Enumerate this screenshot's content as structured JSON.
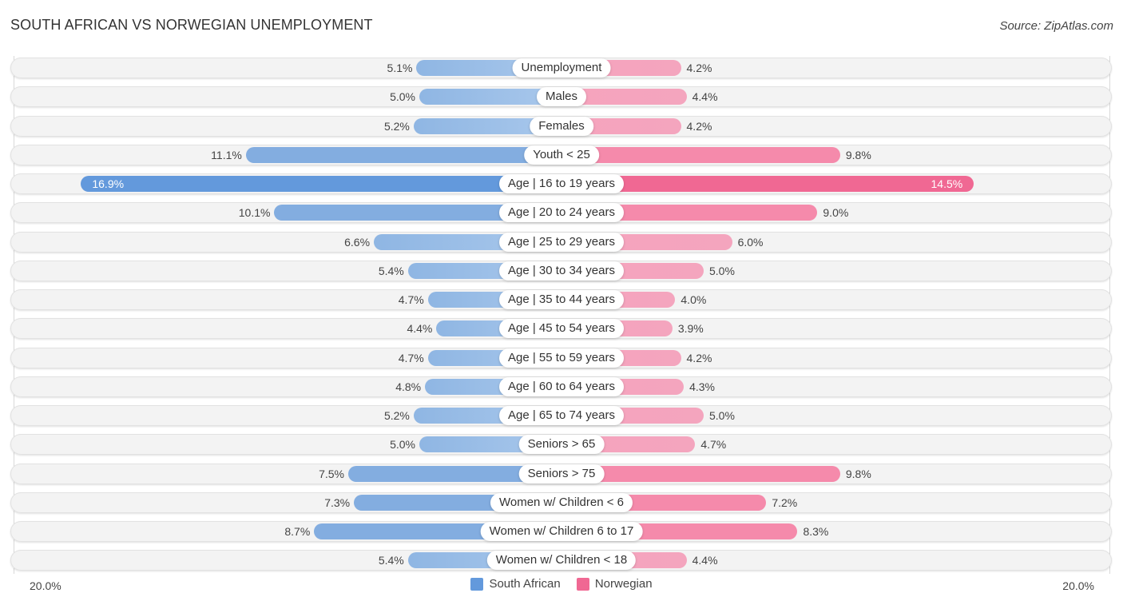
{
  "header": {
    "title": "SOUTH AFRICAN VS NORWEGIAN UNEMPLOYMENT",
    "source": "Source: ZipAtlas.com"
  },
  "colors": {
    "south_african": "#6399dc",
    "norwegian": "#f06893"
  },
  "chart_data": {
    "type": "bar",
    "orientation": "horizontal-diverging",
    "title": "SOUTH AFRICAN VS NORWEGIAN UNEMPLOYMENT",
    "categories": [
      "Unemployment",
      "Males",
      "Females",
      "Youth < 25",
      "Age | 16 to 19 years",
      "Age | 20 to 24 years",
      "Age | 25 to 29 years",
      "Age | 30 to 34 years",
      "Age | 35 to 44 years",
      "Age | 45 to 54 years",
      "Age | 55 to 59 years",
      "Age | 60 to 64 years",
      "Age | 65 to 74 years",
      "Seniors > 65",
      "Seniors > 75",
      "Women w/ Children < 6",
      "Women w/ Children 6 to 17",
      "Women w/ Children < 18"
    ],
    "series": [
      {
        "name": "South African",
        "side": "left",
        "values": [
          5.1,
          5.0,
          5.2,
          11.1,
          16.9,
          10.1,
          6.6,
          5.4,
          4.7,
          4.4,
          4.7,
          4.8,
          5.2,
          5.0,
          7.5,
          7.3,
          8.7,
          5.4
        ],
        "labels": [
          "5.1%",
          "5.0%",
          "5.2%",
          "11.1%",
          "16.9%",
          "10.1%",
          "6.6%",
          "5.4%",
          "4.7%",
          "4.4%",
          "4.7%",
          "4.8%",
          "5.2%",
          "5.0%",
          "7.5%",
          "7.3%",
          "8.7%",
          "5.4%"
        ]
      },
      {
        "name": "Norwegian",
        "side": "right",
        "values": [
          4.2,
          4.4,
          4.2,
          9.8,
          14.5,
          9.0,
          6.0,
          5.0,
          4.0,
          3.9,
          4.2,
          4.3,
          5.0,
          4.7,
          9.8,
          7.2,
          8.3,
          4.4
        ],
        "labels": [
          "4.2%",
          "4.4%",
          "4.2%",
          "9.8%",
          "14.5%",
          "9.0%",
          "6.0%",
          "5.0%",
          "4.0%",
          "3.9%",
          "4.2%",
          "4.3%",
          "5.0%",
          "4.7%",
          "9.8%",
          "7.2%",
          "8.3%",
          "4.4%"
        ]
      }
    ],
    "xlim": [
      -20,
      20
    ],
    "axis_labels": {
      "left": "20.0%",
      "right": "20.0%"
    },
    "legend": {
      "placement": "bottom-center",
      "entries": [
        "South African",
        "Norwegian"
      ]
    },
    "unit": "%"
  }
}
